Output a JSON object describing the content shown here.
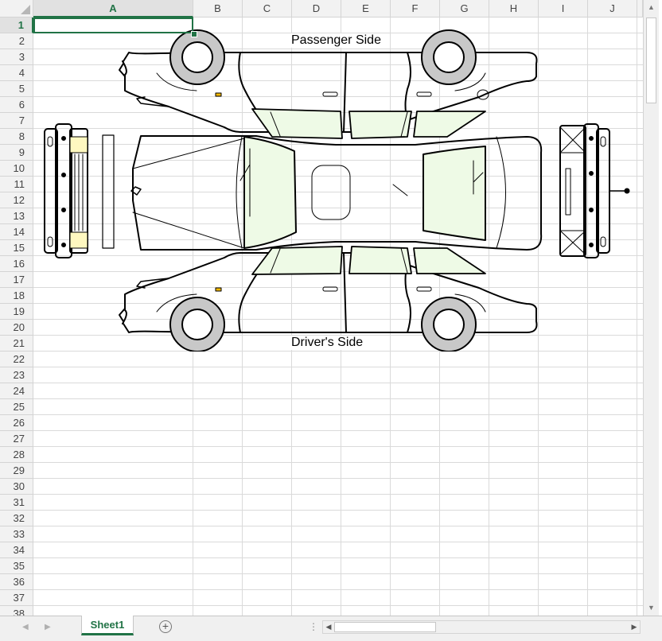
{
  "spreadsheet": {
    "columns": [
      "A",
      "B",
      "C",
      "D",
      "E",
      "F",
      "G",
      "H",
      "I",
      "J"
    ],
    "selected_column": "A",
    "rows": [
      "1",
      "2",
      "3",
      "4",
      "5",
      "6",
      "7",
      "8",
      "9",
      "10",
      "11",
      "12",
      "13",
      "14",
      "15",
      "16",
      "17",
      "18",
      "19",
      "20",
      "21",
      "22",
      "23",
      "24",
      "25",
      "26",
      "27",
      "28",
      "29",
      "30",
      "31",
      "32",
      "33",
      "34",
      "35",
      "36",
      "37",
      "38"
    ],
    "selected_row": "1",
    "labels": {
      "passenger_side": "Passenger Side",
      "drivers_side": "Driver's Side"
    }
  },
  "tabs": {
    "sheets": [
      "Sheet1"
    ],
    "active": "Sheet1",
    "add_sheet_symbol": "+",
    "nav_prev": "◀",
    "nav_next": "▶"
  },
  "colors": {
    "accent": "#217346",
    "glass": "#eefae6",
    "tire": "#c8c8c8",
    "light_yellow": "#fff8c0",
    "marker_orange": "#f5b800"
  }
}
